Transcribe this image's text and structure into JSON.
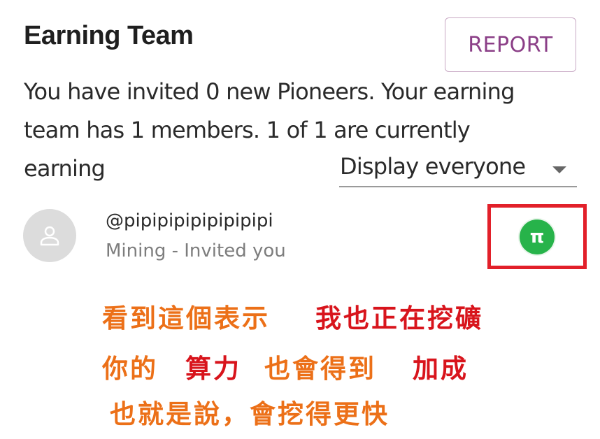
{
  "header": {
    "title": "Earning Team",
    "report_label": "REPORT"
  },
  "summary": {
    "line1": "You have invited 0 new Pioneers. Your earning",
    "line2": "team has 1 members. 1 of 1 are currently",
    "line3": "earning"
  },
  "filter": {
    "selected": "Display everyone"
  },
  "members": [
    {
      "username": "@pipipipipipipipipi",
      "status": "Mining - Invited you",
      "avatar_icon": "person-icon",
      "badge_icon": "pi-icon",
      "badge_symbol": "π",
      "badge_color": "#27b34a"
    }
  ],
  "annotation": {
    "box_color": "#e2202a",
    "line1_part1": "看到這個表示",
    "line1_part2": "我也正在挖礦",
    "line2_part1": "你的",
    "line2_part2": "算力",
    "line2_part3": "也會得到",
    "line2_part4": "加成",
    "line3": "也就是說，會挖得更快",
    "colors": {
      "orange": "#ec7018",
      "red": "#d8141c"
    }
  }
}
